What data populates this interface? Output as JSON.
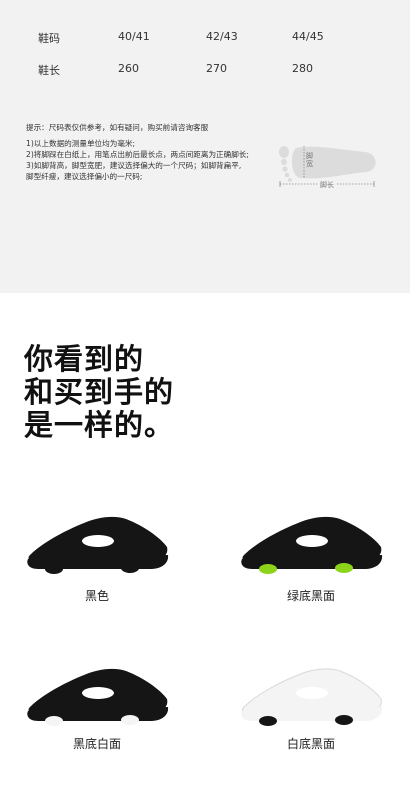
{
  "size_table": {
    "row1": {
      "label": "鞋码",
      "values": [
        "40/41",
        "42/43",
        "44/45"
      ]
    },
    "row2": {
      "label": "鞋长",
      "values": [
        "260",
        "270",
        "280"
      ]
    }
  },
  "tips": {
    "title": "提示：尺码表仅供参考，如有疑问，购买前请咨询客服",
    "lines": [
      "1)以上数据的测量单位均为毫米;",
      "2)将脚踩在白纸上，用笔点出前后最长点，两点间距离为正确脚长;",
      "3)如脚背高，脚型宽肥，建议选择偏大的一个尺码；如脚背扁平,",
      "脚型纤瘦，建议选择偏小的一尺码;"
    ]
  },
  "foot_diagram": {
    "width_label": "脚宽",
    "length_label": "脚长"
  },
  "headline": [
    "你看到的",
    "和买到手的",
    "是一样的。"
  ],
  "products": [
    {
      "label": "黑色",
      "upper": "#151515",
      "sole": "#151515",
      "accent": "#151515"
    },
    {
      "label": "绿底黑面",
      "upper": "#151515",
      "sole": "#151515",
      "accent": "#8cd31a"
    },
    {
      "label": "黑底白面",
      "upper": "#151515",
      "sole": "#151515",
      "accent": "#f5f5f5"
    },
    {
      "label": "白底黑面",
      "upper": "#f4f4f4",
      "sole": "#f4f4f4",
      "accent": "#151515"
    }
  ]
}
